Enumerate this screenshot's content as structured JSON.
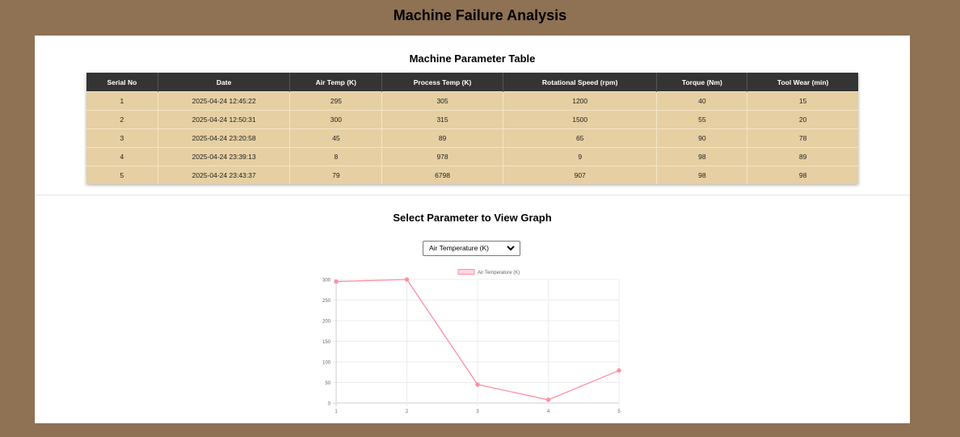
{
  "header": {
    "title": "Machine Failure Analysis"
  },
  "table_section": {
    "title": "Machine Parameter Table"
  },
  "table": {
    "columns": [
      "Serial No",
      "Date",
      "Air Temp (K)",
      "Process Temp (K)",
      "Rotational Speed (rpm)",
      "Torque (Nm)",
      "Tool Wear (min)"
    ],
    "rows": [
      [
        "1",
        "2025-04-24 12:45:22",
        "295",
        "305",
        "1200",
        "40",
        "15"
      ],
      [
        "2",
        "2025-04-24 12:50:31",
        "300",
        "315",
        "1500",
        "55",
        "20"
      ],
      [
        "3",
        "2025-04-24 23:20:58",
        "45",
        "89",
        "65",
        "90",
        "78"
      ],
      [
        "4",
        "2025-04-24 23:39:13",
        "8",
        "978",
        "9",
        "98",
        "89"
      ],
      [
        "5",
        "2025-04-24 23:43:37",
        "79",
        "6798",
        "907",
        "98",
        "98"
      ]
    ]
  },
  "graph_section": {
    "title": "Select Parameter to View Graph",
    "select": {
      "selected": "Air Temperature (K)",
      "icon": "chevron-down-icon"
    }
  },
  "chart_data": {
    "type": "line",
    "x": [
      1,
      2,
      3,
      4,
      5
    ],
    "series": [
      {
        "name": "Air Temperature (K)",
        "values": [
          295,
          300,
          45,
          8,
          79
        ],
        "color": "#ff8fa3"
      }
    ],
    "xlabel": "",
    "ylabel": "",
    "ylim": [
      0,
      300
    ],
    "yticks": [
      0,
      50,
      100,
      150,
      200,
      250,
      300
    ],
    "grid": true,
    "legend": "top-center"
  },
  "colors": {
    "background": "#8f7153",
    "panel": "#ffffff",
    "table_header": "#343434",
    "table_row": "#e6cfa2",
    "line": "#ff8fa3"
  }
}
